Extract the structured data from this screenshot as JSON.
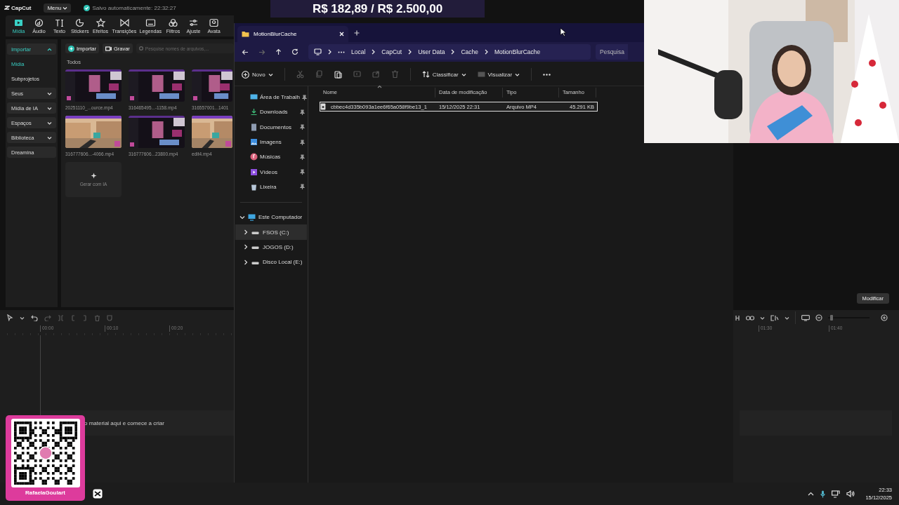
{
  "capcut": {
    "logo": "CapCut",
    "menu": "Menu",
    "autosave": "Salvo automaticamente: 22:32:27",
    "tools": [
      {
        "label": "Mídia",
        "selected": true
      },
      {
        "label": "Áudio",
        "selected": false
      },
      {
        "label": "Texto",
        "selected": false
      },
      {
        "label": "Stickers",
        "selected": false
      },
      {
        "label": "Efeitos",
        "selected": false
      },
      {
        "label": "Transições",
        "selected": false
      },
      {
        "label": "Legendas",
        "selected": false
      },
      {
        "label": "Filtros",
        "selected": false
      },
      {
        "label": "Ajuste",
        "selected": false
      },
      {
        "label": "Avata",
        "selected": false
      }
    ],
    "sidebar": [
      {
        "kind": "section",
        "label": "Importar",
        "expanded": true
      },
      {
        "kind": "entry",
        "label": "Mídia",
        "selected": true
      },
      {
        "kind": "entry",
        "label": "Subprojetos",
        "selected": false
      },
      {
        "kind": "section",
        "label": "Seus",
        "expanded": false
      },
      {
        "kind": "section",
        "label": "Mídia de IA",
        "expanded": false
      },
      {
        "kind": "section",
        "label": "Espaços",
        "expanded": false
      },
      {
        "kind": "section",
        "label": "Biblioteca",
        "expanded": false
      },
      {
        "kind": "box",
        "label": "Dreamina"
      }
    ],
    "media": {
      "import_button": "Importar",
      "record_button": "Gravar",
      "search_placeholder": "Pesquise nomes de arquivos,...",
      "section_title": "Todos",
      "files": [
        {
          "name": "20251110_...ource.mp4"
        },
        {
          "name": "316465495...-1158.mp4"
        },
        {
          "name": "316557001...1401"
        },
        {
          "name": "316777606...-4066.mp4"
        },
        {
          "name": "316777606...23800.mp4"
        },
        {
          "name": "edit4.mp4"
        }
      ],
      "generate_card": "Gerar com IA"
    },
    "timeline": {
      "ruler": [
        "00:00",
        "00:10",
        "00:20"
      ],
      "drop_hint": "o material aqui e comece a criar"
    },
    "side_panel": {
      "modify_button": "Modificar",
      "ruler": [
        "01:30",
        "01:40"
      ],
      "zoom_slider": {
        "level": 0.05
      }
    }
  },
  "goal_banner": "R$ 182,89 / R$ 2.500,00",
  "explorer": {
    "tab": "MotionBlurCache",
    "breadcrumb": [
      "Local",
      "CapCut",
      "User Data",
      "Cache",
      "MotionBlurCache"
    ],
    "search_placeholder": "Pesquisa",
    "new_button": "Novo",
    "actions": [
      {
        "disabled": true
      },
      {
        "disabled": true
      },
      {
        "disabled": false
      },
      {
        "disabled": true
      },
      {
        "disabled": true
      },
      {
        "disabled": true
      }
    ],
    "sort_button": "Classificar",
    "view_button": "Visualizar",
    "quick_access": [
      {
        "label": "Área de Trabalh",
        "pinned": true
      },
      {
        "label": "Downloads",
        "pinned": true
      },
      {
        "label": "Documentos",
        "pinned": true
      },
      {
        "label": "Imagens",
        "pinned": true
      },
      {
        "label": "Músicas",
        "pinned": true
      },
      {
        "label": "Vídeos",
        "pinned": true
      },
      {
        "label": "Lixeira",
        "pinned": true
      }
    ],
    "computer": {
      "label": "Este Computador",
      "expanded": true,
      "children": [
        {
          "label": "FSOS (C:)",
          "selected": true,
          "expanded": false
        },
        {
          "label": "JOGOS (D:)",
          "selected": false,
          "expanded": false
        },
        {
          "label": "Disco Local (E:)",
          "selected": false,
          "expanded": false
        }
      ]
    },
    "columns": [
      "Nome",
      "Data de modificação",
      "Tipo",
      "Tamanho"
    ],
    "rows": [
      {
        "name": "cbbec4d335b093a1ee6f65a058f9be13_1",
        "modified": "15/12/2025 22:31",
        "type": "Arquivo MP4",
        "size": "45.291 KB",
        "selected": true
      }
    ]
  },
  "qr_card": {
    "handle": "RafaelaGoulart"
  },
  "taskbar": {
    "time": "22:33",
    "date": "15/12/2025"
  }
}
